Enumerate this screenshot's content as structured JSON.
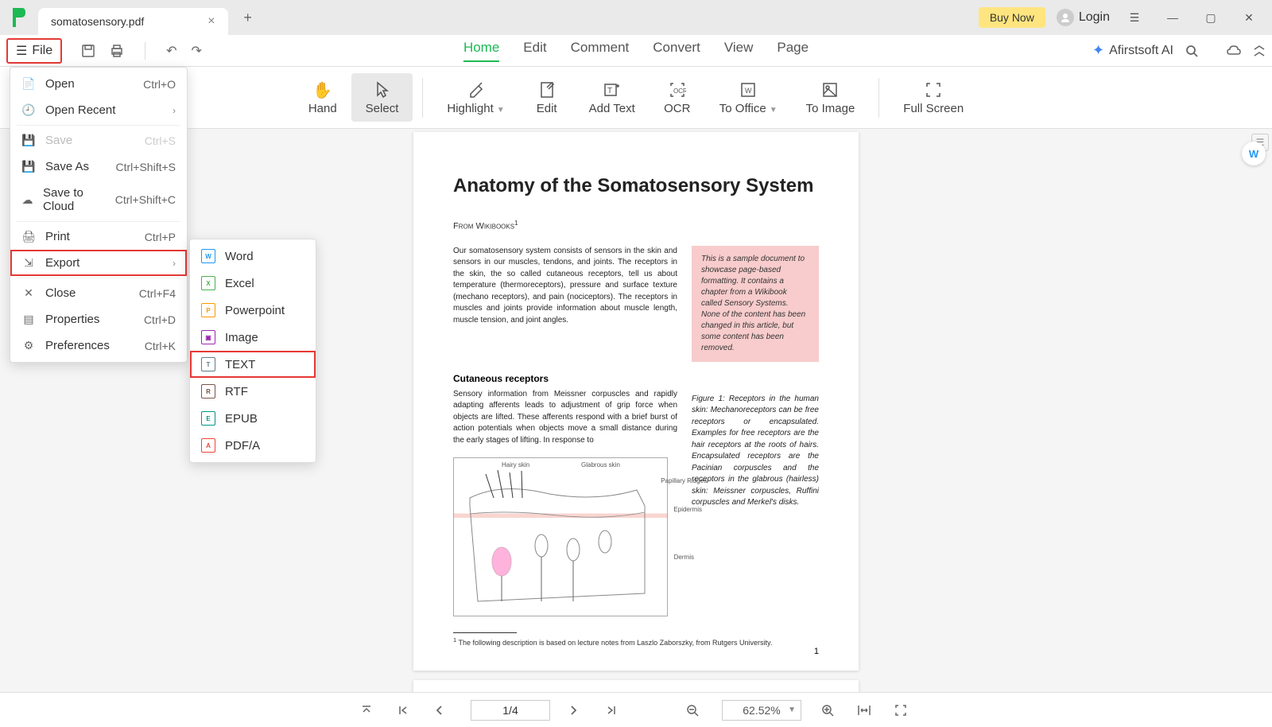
{
  "titlebar": {
    "tab_name": "somatosensory.pdf",
    "buy_label": "Buy Now",
    "login_label": "Login"
  },
  "toolbar1": {
    "file_label": "File"
  },
  "main_tabs": {
    "home": "Home",
    "edit": "Edit",
    "comment": "Comment",
    "convert": "Convert",
    "view": "View",
    "page": "Page"
  },
  "ai": {
    "label": "Afirstsoft AI"
  },
  "ribbon": {
    "hand": "Hand",
    "select": "Select",
    "highlight": "Highlight",
    "edit": "Edit",
    "add_text": "Add Text",
    "ocr": "OCR",
    "to_office": "To Office",
    "to_image": "To Image",
    "full_screen": "Full Screen"
  },
  "file_menu": {
    "open": {
      "label": "Open",
      "shortcut": "Ctrl+O"
    },
    "open_recent": {
      "label": "Open Recent"
    },
    "save": {
      "label": "Save",
      "shortcut": "Ctrl+S"
    },
    "save_as": {
      "label": "Save As",
      "shortcut": "Ctrl+Shift+S"
    },
    "save_cloud": {
      "label": "Save to Cloud",
      "shortcut": "Ctrl+Shift+C"
    },
    "print": {
      "label": "Print",
      "shortcut": "Ctrl+P"
    },
    "export": {
      "label": "Export"
    },
    "close": {
      "label": "Close",
      "shortcut": "Ctrl+F4"
    },
    "properties": {
      "label": "Properties",
      "shortcut": "Ctrl+D"
    },
    "preferences": {
      "label": "Preferences",
      "shortcut": "Ctrl+K"
    }
  },
  "export_menu": {
    "word": "Word",
    "excel": "Excel",
    "powerpoint": "Powerpoint",
    "image": "Image",
    "text": "TEXT",
    "rtf": "RTF",
    "epub": "EPUB",
    "pdfa": "PDF/A"
  },
  "document": {
    "title": "Anatomy of the Somatosensory System",
    "source": "From Wikibooks",
    "para1": "Our somatosensory system consists of sensors in the skin and sensors in our muscles, tendons, and joints. The receptors in the skin, the so called cutaneous receptors, tell us about temperature (thermoreceptors), pressure and surface texture (mechano receptors), and pain (nociceptors). The receptors in muscles and joints provide information about muscle length, muscle tension, and joint angles.",
    "sidebar_note": "This is a sample document to showcase page-based formatting. It contains a chapter from a Wikibook called Sensory Systems. None of the content has been changed in this article, but some content has been removed.",
    "subhead": "Cutaneous receptors",
    "para2": "Sensory information from Meissner corpuscles and rapidly adapting afferents leads to adjustment of grip force when objects are lifted. These afferents respond with a brief burst of action potentials when objects move a small distance during the early stages of lifting. In response to",
    "diag_labels": {
      "hairy": "Hairy skin",
      "glabrous": "Glabrous skin",
      "papillary": "Papillary Ridges",
      "epidermis": "Epidermis",
      "dermis": "Dermis"
    },
    "fig_caption": "Figure 1: Receptors in the human skin: Mechanoreceptors can be free receptors or encapsulated. Examples for free receptors are the hair receptors at the roots of hairs. Encapsulated receptors are the Pacinian corpuscles and the receptors in the glabrous (hairless) skin: Meissner corpuscles, Ruffini corpuscles and Merkel's disks.",
    "footnote": "The following description is based on lecture notes from Laszlo Zaborszky, from Rutgers University.",
    "page_number": "1"
  },
  "statusbar": {
    "page": "1/4",
    "zoom": "62.52%"
  }
}
